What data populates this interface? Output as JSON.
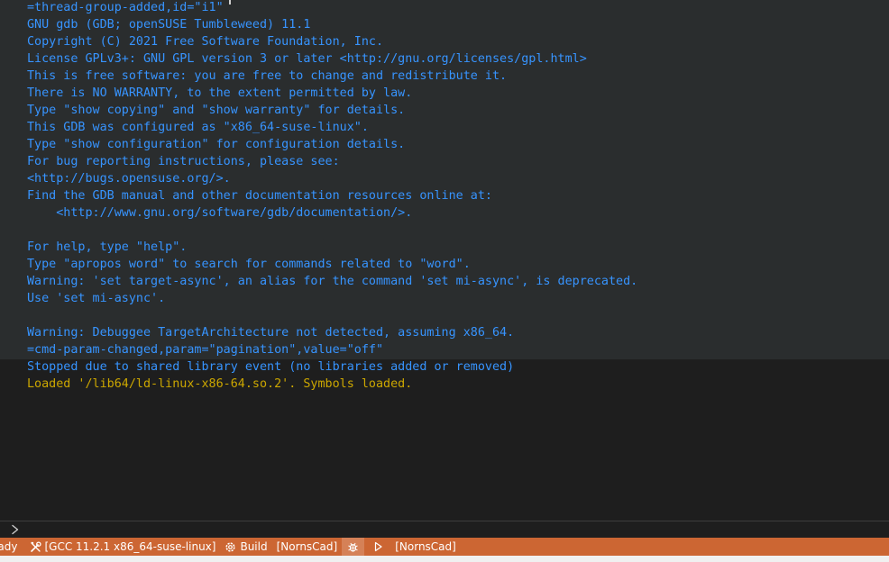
{
  "console": {
    "lines": [
      {
        "kind": "info",
        "text": "=thread-group-added,id=\"i1\""
      },
      {
        "kind": "info",
        "text": "GNU gdb (GDB; openSUSE Tumbleweed) 11.1"
      },
      {
        "kind": "info",
        "text": "Copyright (C) 2021 Free Software Foundation, Inc."
      },
      {
        "kind": "info",
        "text": "License GPLv3+: GNU GPL version 3 or later <http://gnu.org/licenses/gpl.html>"
      },
      {
        "kind": "info",
        "text": "This is free software: you are free to change and redistribute it."
      },
      {
        "kind": "info",
        "text": "There is NO WARRANTY, to the extent permitted by law."
      },
      {
        "kind": "info",
        "text": "Type \"show copying\" and \"show warranty\" for details."
      },
      {
        "kind": "info",
        "text": "This GDB was configured as \"x86_64-suse-linux\"."
      },
      {
        "kind": "info",
        "text": "Type \"show configuration\" for configuration details."
      },
      {
        "kind": "info",
        "text": "For bug reporting instructions, please see:"
      },
      {
        "kind": "info",
        "text": "<http://bugs.opensuse.org/>."
      },
      {
        "kind": "info",
        "text": "Find the GDB manual and other documentation resources online at:"
      },
      {
        "kind": "info",
        "text": "    <http://www.gnu.org/software/gdb/documentation/>."
      },
      {
        "kind": "info",
        "text": ""
      },
      {
        "kind": "info",
        "text": "For help, type \"help\"."
      },
      {
        "kind": "info",
        "text": "Type \"apropos word\" to search for commands related to \"word\"."
      },
      {
        "kind": "info",
        "text": "Warning: 'set target-async', an alias for the command 'set mi-async', is deprecated."
      },
      {
        "kind": "info",
        "text": "Use 'set mi-async'."
      },
      {
        "kind": "info",
        "text": ""
      },
      {
        "kind": "info",
        "text": "Warning: Debuggee TargetArchitecture not detected, assuming x86_64."
      },
      {
        "kind": "info",
        "text": "=cmd-param-changed,param=\"pagination\",value=\"off\""
      },
      {
        "kind": "stopped",
        "text": "Stopped due to shared library event (no libraries added or removed)"
      },
      {
        "kind": "loaded",
        "text": "Loaded '/lib64/ld-linux-x86-64.so.2'. Symbols loaded."
      }
    ]
  },
  "input": {
    "value": "",
    "prompt_icon": "chevron-right-icon"
  },
  "status_bar": {
    "ready": "eady",
    "kit": {
      "icon": "tools-icon",
      "label": "[GCC 11.2.1 x86_64-suse-linux]"
    },
    "build": {
      "icon": "gear-icon",
      "label": "Build"
    },
    "build_target": "[NornsCad]",
    "debug": {
      "icon": "bug-icon"
    },
    "run": {
      "icon": "play-icon"
    },
    "launch_target": "[NornsCad]"
  },
  "colors": {
    "console_background": "#1e1e1e",
    "highlight_band": "#2a2d2e",
    "info_text": "#3794ff",
    "loaded_text": "#cca700",
    "status_bar": "#cc6633"
  }
}
